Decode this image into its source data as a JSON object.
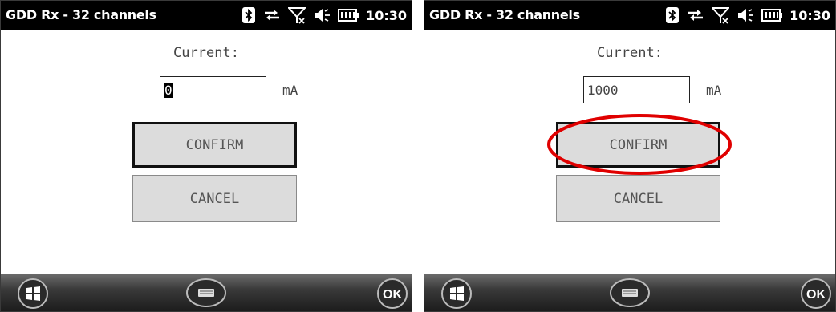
{
  "screens": [
    {
      "title": "GDD Rx - 32 channels",
      "clock": "10:30",
      "current_label": "Current:",
      "current_value": "0",
      "unit": "mA",
      "confirm_label": "CONFIRM",
      "cancel_label": "CANCEL",
      "ok_label": "OK"
    },
    {
      "title": "GDD Rx - 32 channels",
      "clock": "10:30",
      "current_label": "Current:",
      "current_value": "1000",
      "unit": "mA",
      "confirm_label": "CONFIRM",
      "cancel_label": "CANCEL",
      "ok_label": "OK"
    }
  ],
  "status_icons": [
    "bluetooth-icon",
    "sync-arrows-icon",
    "no-signal-icon",
    "speaker-icon",
    "battery-icon"
  ],
  "bottom_bar_icons": [
    "windows-start-icon",
    "keyboard-icon",
    "ok-button"
  ],
  "annotation": {
    "highlight_color": "#e00000",
    "highlights": "confirm-button on right screen"
  }
}
